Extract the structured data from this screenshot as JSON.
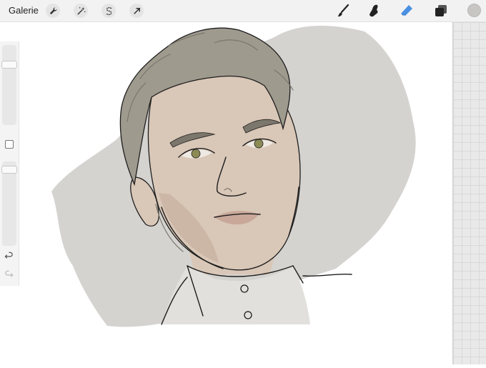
{
  "toolbar": {
    "gallery_label": "Galerie",
    "left_tools": [
      {
        "name": "wrench-icon"
      },
      {
        "name": "magic-wand-icon"
      },
      {
        "name": "selection-s-icon"
      },
      {
        "name": "transform-arrow-icon"
      }
    ],
    "right_tools": [
      {
        "name": "brush-icon"
      },
      {
        "name": "smudge-icon"
      },
      {
        "name": "eraser-icon"
      },
      {
        "name": "layers-icon"
      }
    ],
    "active_tool": "eraser-icon",
    "active_color": "#4a90e2",
    "current_color": "#c8c6c3"
  },
  "sidebar": {
    "brush_size_level": 0.22,
    "opacity_level": 0.06,
    "undo_icon": "undo-arrow-icon",
    "redo_icon": "redo-arrow-icon"
  },
  "canvas": {
    "artwork": "portrait-illustration",
    "palette": {
      "background_wash": "#d4d3d0",
      "skin": "#d9c7b7",
      "skin_shadow": "#c6b09e",
      "hair": "#9f9a8e",
      "hair_dark": "#7c776c",
      "eye": "#8c8a55",
      "lips": "#c9a89a",
      "collar": "#e2e0dd",
      "line": "#1e1e1e"
    }
  }
}
